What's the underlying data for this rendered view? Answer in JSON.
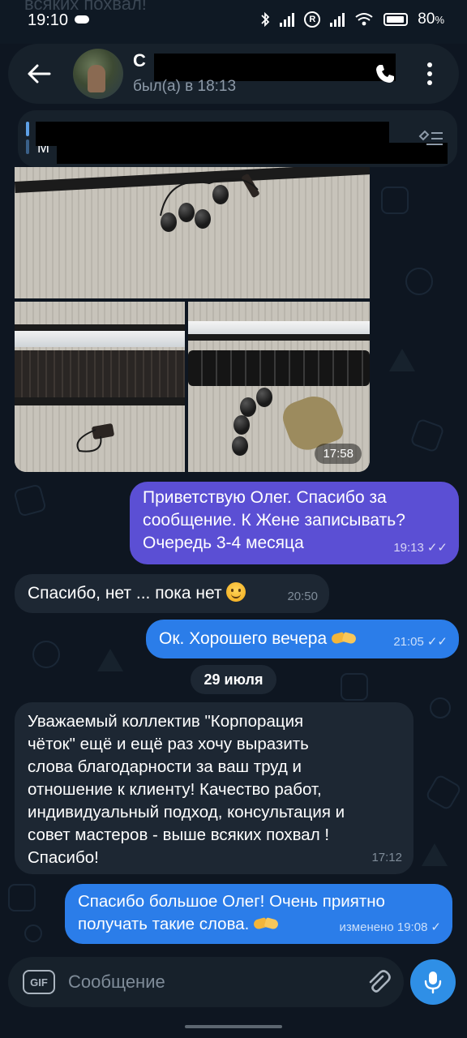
{
  "status_bar": {
    "time": "19:10",
    "battery": "80",
    "ghost_text": "всяких похвал!"
  },
  "header": {
    "contact_name": "С",
    "last_seen": "был(а) в 18:13"
  },
  "pinned": {
    "title": "",
    "text": "М"
  },
  "media": {
    "time": "17:58"
  },
  "messages": [
    {
      "text_lines": [
        "Приветствую Олег. Спасибо за",
        "сообщение. К Жене записывать?",
        "Очередь 3-4 месяца"
      ],
      "time": "19:13",
      "status": "read"
    },
    {
      "text": "Спасибо, нет ... пока нет",
      "time": "20:50"
    },
    {
      "text": "Ок. Хорошего вечера",
      "time": "21:05",
      "status": "read"
    },
    {
      "text_lines": [
        "Уважаемый коллектив \"Корпорация",
        "чёток\" ещё  и ещё раз хочу выразить",
        "слова благодарности за ваш труд и",
        "отношение к клиенту!  Качество работ,",
        "индивидуальный подход, консультация и",
        "совет мастеров - выше всяких похвал !",
        "Спасибо!"
      ],
      "time": "17:12"
    },
    {
      "text_lines": [
        "Спасибо большое Олег! Очень приятно",
        "получать такие слова."
      ],
      "time": "изменено 19:08",
      "status": "sent"
    }
  ],
  "date_separator": "29 июля",
  "composer": {
    "gif_label": "GIF",
    "placeholder": "Сообщение"
  },
  "colors": {
    "background": "#0e1621",
    "incoming_bubble": "#1d2733",
    "outgoing_purple": "#5b4fd4",
    "outgoing_blue": "#2b7de9",
    "mic_button": "#2f8fe6",
    "accent": "#5ea0e6"
  },
  "icons": [
    "back-arrow-icon",
    "phone-icon",
    "more-vertical-icon",
    "pinned-list-icon",
    "gif-icon",
    "paperclip-icon",
    "microphone-icon",
    "double-check-icon",
    "single-check-icon",
    "smiling-face-emoji",
    "handshake-emoji"
  ]
}
